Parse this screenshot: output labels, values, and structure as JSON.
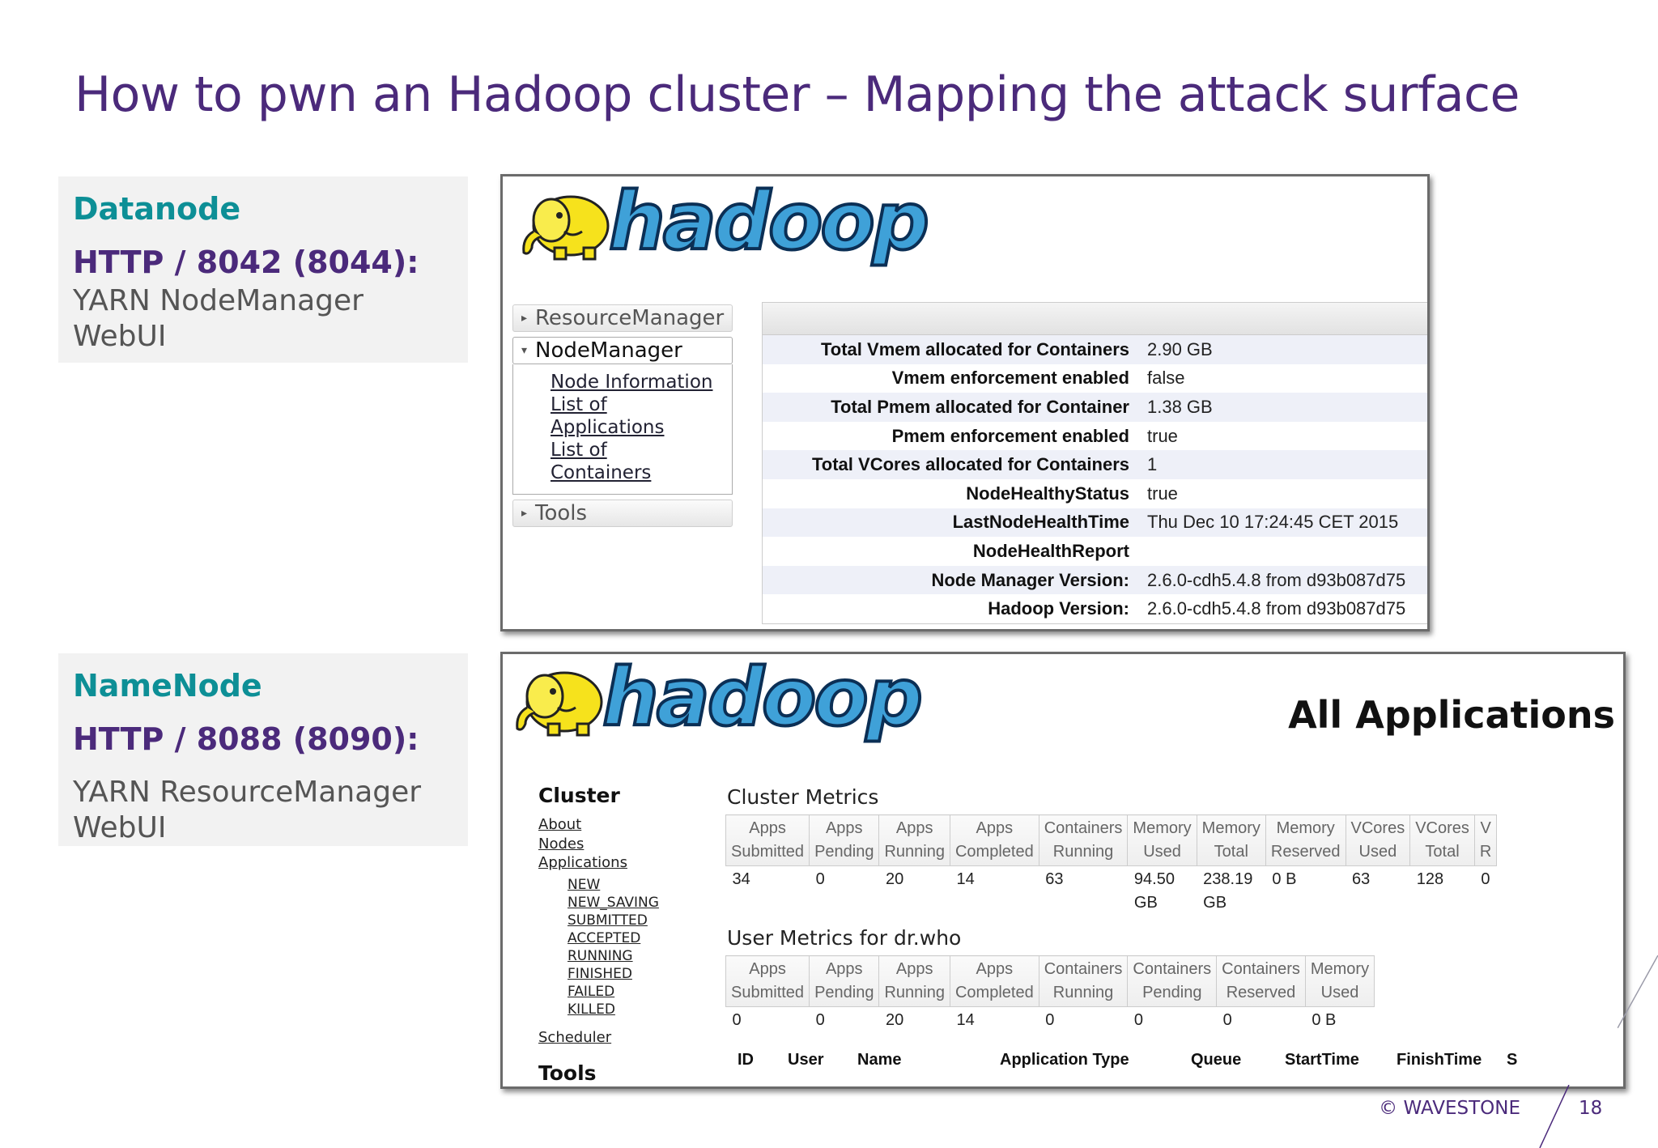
{
  "slide": {
    "title": "How to pwn an Hadoop cluster – Mapping the attack surface",
    "footer_brand": "© WAVESTONE",
    "page_number": "18"
  },
  "boxes": [
    {
      "heading": "Datanode",
      "port": "HTTP / 8042 (8044):",
      "desc": "YARN NodeManager WebUI"
    },
    {
      "heading": "NameNode",
      "port": "HTTP / 8088 (8090):",
      "desc": "YARN ResourceManager WebUI"
    }
  ],
  "logo_text": "hadoop",
  "nodemanager": {
    "nav": {
      "resourcemanager": "ResourceManager",
      "nodemanager": "NodeManager",
      "links": [
        "Node Information",
        "List of",
        "Applications",
        "List of",
        "Containers"
      ],
      "tools": "Tools"
    },
    "rows": [
      {
        "k": "Total Vmem allocated for Containers",
        "v": "2.90 GB"
      },
      {
        "k": "Vmem enforcement enabled",
        "v": "false"
      },
      {
        "k": "Total Pmem allocated for Container",
        "v": "1.38 GB"
      },
      {
        "k": "Pmem enforcement enabled",
        "v": "true"
      },
      {
        "k": "Total VCores allocated for Containers",
        "v": "1"
      },
      {
        "k": "NodeHealthyStatus",
        "v": "true"
      },
      {
        "k": "LastNodeHealthTime",
        "v": "Thu Dec 10 17:24:45 CET 2015"
      },
      {
        "k": "NodeHealthReport",
        "v": ""
      },
      {
        "k": "Node Manager Version:",
        "v": "2.6.0-cdh5.4.8 from d93b087d75"
      },
      {
        "k": "Hadoop Version:",
        "v": "2.6.0-cdh5.4.8 from d93b087d75"
      }
    ]
  },
  "resourcemanager": {
    "page_heading": "All Applications",
    "nav": {
      "cluster": "Cluster",
      "links": [
        "About",
        "Nodes",
        "Applications"
      ],
      "states": [
        "NEW",
        "NEW_SAVING",
        "SUBMITTED",
        "ACCEPTED",
        "RUNNING",
        "FINISHED",
        "FAILED",
        "KILLED"
      ],
      "scheduler": "Scheduler",
      "tools": "Tools"
    },
    "cluster_metrics": {
      "title": "Cluster Metrics",
      "headers": [
        [
          "Apps",
          "Submitted"
        ],
        [
          "Apps",
          "Pending"
        ],
        [
          "Apps",
          "Running"
        ],
        [
          "Apps",
          "Completed"
        ],
        [
          "Containers",
          "Running"
        ],
        [
          "Memory",
          "Used"
        ],
        [
          "Memory",
          "Total"
        ],
        [
          "Memory",
          "Reserved"
        ],
        [
          "VCores",
          "Used"
        ],
        [
          "VCores",
          "Total"
        ],
        [
          "V",
          "R"
        ]
      ],
      "values": [
        [
          "34"
        ],
        [
          "0"
        ],
        [
          "20"
        ],
        [
          "14"
        ],
        [
          "63"
        ],
        [
          "94.50",
          "GB"
        ],
        [
          "238.19",
          "GB"
        ],
        [
          "0 B"
        ],
        [
          "63"
        ],
        [
          "128"
        ],
        [
          "0"
        ]
      ]
    },
    "user_metrics": {
      "title": "User Metrics for dr.who",
      "headers": [
        [
          "Apps",
          "Submitted"
        ],
        [
          "Apps",
          "Pending"
        ],
        [
          "Apps",
          "Running"
        ],
        [
          "Apps",
          "Completed"
        ],
        [
          "Containers",
          "Running"
        ],
        [
          "Containers",
          "Pending"
        ],
        [
          "Containers",
          "Reserved"
        ],
        [
          "Memory",
          "Used"
        ]
      ],
      "values": [
        "0",
        "0",
        "20",
        "14",
        "0",
        "0",
        "0",
        "0 B"
      ]
    },
    "apps_columns": [
      "ID",
      "User",
      "Name",
      "Application Type",
      "Queue",
      "StartTime",
      "FinishTime",
      "S"
    ]
  }
}
